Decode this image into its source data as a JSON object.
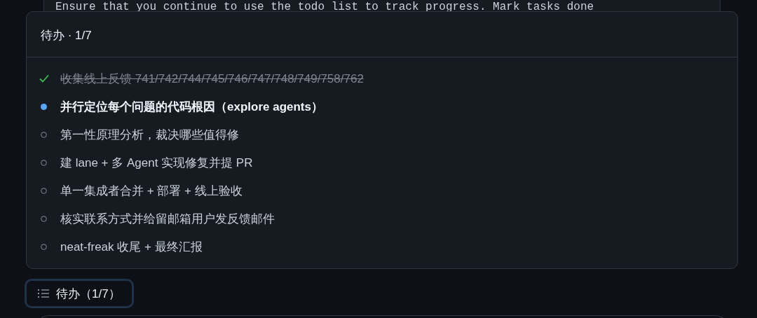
{
  "code_block": {
    "text": "Ensure that you continue to use the todo list to track progress. Mark tasks done"
  },
  "todo_panel": {
    "title": "待办 · 1/7",
    "items": [
      {
        "text": "收集线上反馈 741/742/744/745/746/747/748/749/758/762",
        "kind": "done"
      },
      {
        "text": "并行定位每个问题的代码根因（explore agents）",
        "kind": "active"
      },
      {
        "text": "第一性原理分析，裁决哪些值得修",
        "kind": "pending"
      },
      {
        "text": "建 lane + 多 Agent 实现修复并提 PR",
        "kind": "pending"
      },
      {
        "text": "单一集成者合并 + 部署 + 线上验收",
        "kind": "pending"
      },
      {
        "text": "核实联系方式并给留邮箱用户发反馈邮件",
        "kind": "pending"
      },
      {
        "text": "neat-freak 收尾 + 最终汇报",
        "kind": "pending"
      }
    ]
  },
  "todo_button": {
    "label": "待办（1/7）"
  }
}
